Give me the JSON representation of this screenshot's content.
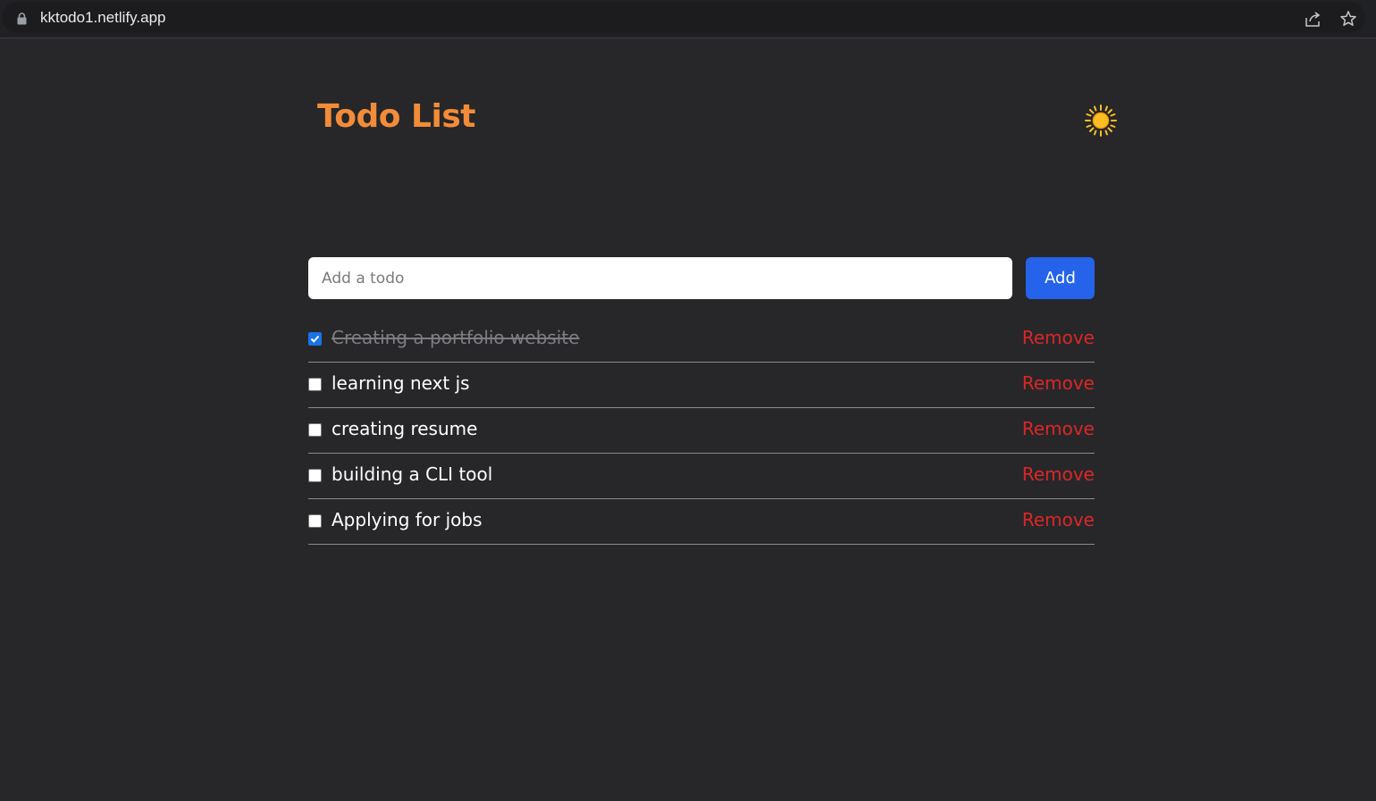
{
  "browser": {
    "url": "kktodo1.netlify.app",
    "icons": [
      "lock-icon",
      "share-icon",
      "star-icon"
    ]
  },
  "app": {
    "title": "Todo List",
    "theme_icon": "sun-icon",
    "input": {
      "placeholder": "Add a todo",
      "value": ""
    },
    "add_label": "Add",
    "todos": [
      {
        "text": "Creating a portfolio website",
        "done": true,
        "remove_label": "Remove"
      },
      {
        "text": "learning next js",
        "done": false,
        "remove_label": "Remove"
      },
      {
        "text": "creating resume",
        "done": false,
        "remove_label": "Remove"
      },
      {
        "text": "building a CLI tool",
        "done": false,
        "remove_label": "Remove"
      },
      {
        "text": "Applying for jobs",
        "done": false,
        "remove_label": "Remove"
      }
    ]
  },
  "colors": {
    "background": "#27272a",
    "title": "#f28c38",
    "add_button": "#2563eb",
    "remove": "#dc2626",
    "sun": "#fbbf24"
  }
}
